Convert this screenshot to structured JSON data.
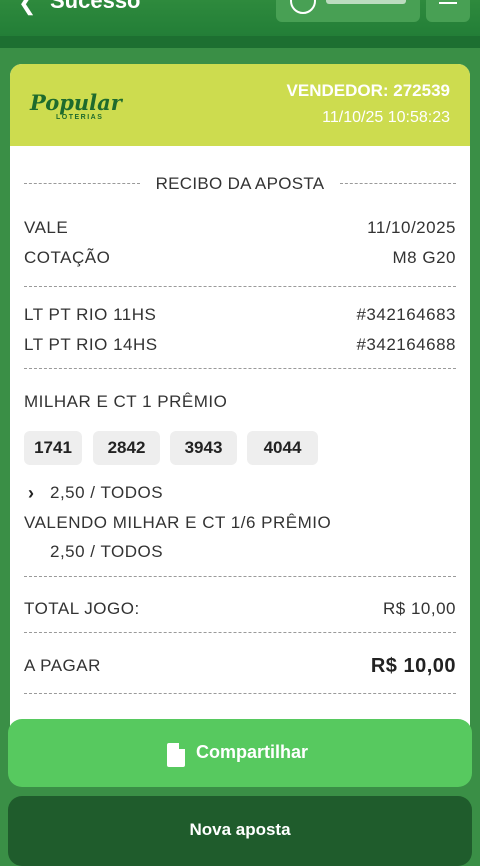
{
  "header": {
    "back_icon": "chevron-left-icon",
    "title": "Sucesso",
    "menu_icon": "hamburger-icon"
  },
  "receipt": {
    "logo_text": "Popular",
    "logo_subtext": "LOTERIAS",
    "vendor": "VENDEDOR: 272539",
    "timestamp": "11/10/25 10:58:23",
    "section_title": "RECIBO DA APOSTA",
    "vale_label": "VALE",
    "vale_value": "11/10/2025",
    "cotacao_label": "COTAÇÃO",
    "cotacao_value": "M8 G20",
    "draws": [
      {
        "name": "LT PT RIO 11HS",
        "id": "#342164683"
      },
      {
        "name": "LT PT RIO 14HS",
        "id": "#342164688"
      }
    ],
    "game_title": "MILHAR E CT 1 PRÊMIO",
    "numbers": [
      "1741",
      "2842",
      "3943",
      "4044"
    ],
    "bet_line": "2,50 / TODOS",
    "valendo_label": "VALENDO MILHAR E CT 1/6 PRÊMIO",
    "valendo_value": "2,50 / TODOS",
    "total_label": "TOTAL JOGO:",
    "total_value": "R$ 10,00",
    "pay_label": "A PAGAR",
    "pay_value": "R$ 10,00"
  },
  "actions": {
    "share_label": "Compartilhar",
    "new_bet_label": "Nova aposta"
  },
  "colors": {
    "header_green": "#1f7a35",
    "card_header": "#cddc4f",
    "share_button": "#57c95f",
    "new_bet_button": "#1f5c2c"
  }
}
